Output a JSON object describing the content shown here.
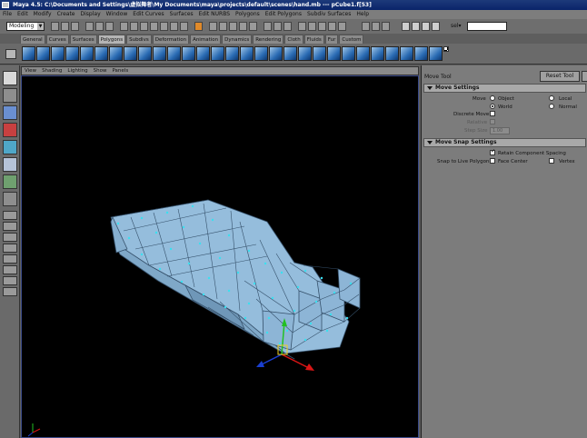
{
  "window": {
    "title": "Maya 4.5: C:\\Documents and Settings\\虚拟舞者\\My Documents\\maya\\projects\\default\\scenes\\hand.mb  ---  pCube1.f[53]"
  },
  "menubar": {
    "items": [
      "File",
      "Edit",
      "Modify",
      "Create",
      "Display",
      "Window",
      "Edit Curves",
      "Surfaces",
      "Edit NURBS",
      "Polygons",
      "Edit Polygons",
      "Subdiv Surfaces",
      "Help"
    ]
  },
  "status_line": {
    "mode": "Modeling",
    "sel_label": "sel▾",
    "sel_value": ""
  },
  "shelf": {
    "tabs": [
      "General",
      "Curves",
      "Surfaces",
      "Polygons",
      "Subdivs",
      "Deformation",
      "Animation",
      "Dynamics",
      "Rendering",
      "Cloth",
      "Fluids",
      "Fur",
      "Custom"
    ],
    "active_tab": "Polygons",
    "icons": [
      "poly-sphere-icon",
      "poly-cube-icon",
      "poly-cylinder-icon",
      "poly-cone-icon",
      "poly-plane-icon",
      "poly-torus-icon",
      "combine-icon",
      "separate-icon",
      "extract-icon",
      "boolean-union-icon",
      "boolean-difference-icon",
      "boolean-intersection-icon",
      "smooth-icon",
      "triangulate-icon",
      "quadrangulate-icon",
      "extrude-face-icon",
      "extrude-edge-icon",
      "bridge-icon",
      "split-icon",
      "cut-faces-icon",
      "merge-vertices-icon",
      "delete-edge-icon",
      "append-polygon-icon",
      "create-polygon-icon",
      "map-planar-icon",
      "map-cylindrical-icon",
      "map-spherical-icon",
      "map-automatic-icon",
      "uv-editor-icon",
      "checker-icon"
    ]
  },
  "panel_menu": {
    "items": [
      "View",
      "Shading",
      "Lighting",
      "Show",
      "Panels"
    ]
  },
  "tool_settings": {
    "title": "Move Tool",
    "reset_button": "Reset Tool",
    "move_settings": {
      "header": "Move Settings",
      "move_label": "Move",
      "options": {
        "object": "Object",
        "local": "Local",
        "world": "World",
        "normal": "Normal"
      },
      "selected": "World",
      "discrete_move": "Discrete Move",
      "discrete_move_checked": false,
      "relative": "Relative",
      "step_size": "Step Size",
      "step_size_value": "1.00"
    },
    "snap_settings": {
      "header": "Move Snap Settings",
      "retain_spacing": "Retain Component Spacing",
      "retain_spacing_checked": true,
      "snap_to_live": "Snap to Live Polygon",
      "face_center": "Face Center",
      "face_center_checked": false,
      "vertex": "Vertex",
      "vertex_checked": false
    }
  },
  "colors": {
    "viewport_bg": "#000000",
    "mesh_fill": "#a2c8e6",
    "mesh_edge": "#35506a",
    "vertex_dot": "#39e0f0",
    "manip_x": "#d81515",
    "manip_y": "#22c022",
    "manip_z": "#1a3fd0"
  }
}
